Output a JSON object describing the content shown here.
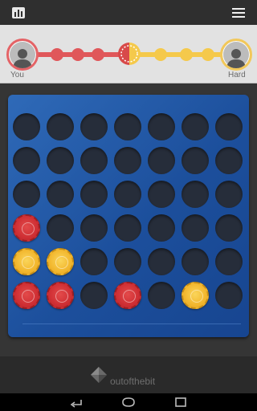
{
  "app": {
    "icons": {
      "stats": "stats-icon",
      "menu": "menu-icon"
    },
    "colors": {
      "red": "#cf2f34",
      "yellow": "#f2b72e",
      "board": "#1c4f9c"
    }
  },
  "match": {
    "player_label": "You",
    "opponent_label": "Hard",
    "progress_nodes": [
      "red",
      "red",
      "red",
      "half",
      "yellow",
      "yellow",
      "yellow"
    ]
  },
  "board": {
    "rows": 6,
    "columns": 7,
    "grid": [
      [
        "",
        "",
        "",
        "",
        "",
        "",
        ""
      ],
      [
        "",
        "",
        "",
        "",
        "",
        "",
        ""
      ],
      [
        "",
        "",
        "",
        "",
        "",
        "",
        ""
      ],
      [
        "red",
        "",
        "",
        "",
        "",
        "",
        ""
      ],
      [
        "yellow",
        "yellow",
        "",
        "",
        "",
        "",
        ""
      ],
      [
        "red",
        "red",
        "",
        "red",
        "",
        "yellow",
        ""
      ]
    ]
  },
  "footer": {
    "brand": "outofthebit"
  }
}
